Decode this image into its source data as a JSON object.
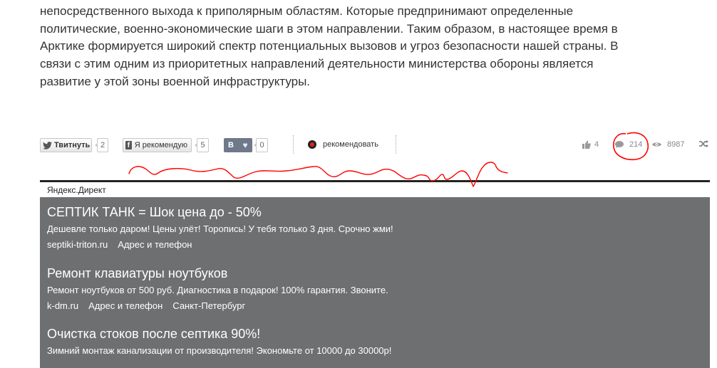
{
  "article": {
    "lines": [
      "непосредственного выхода к приполярным областям. Которые предпринимают определенные",
      "политические, военно-экономические шаги в этом направлении. Таким образом, в настоящее время в",
      "Арктике формируется широкий спектр потенциальных вызовов и угроз безопасности нашей страны. В",
      "связи с этим одним из приоритетных направлений деятельности министерства обороны является",
      "развитие у этой зоны военной инфраструктуры."
    ]
  },
  "share": {
    "twitter_label": "Твитнуть",
    "twitter_count": "2",
    "facebook_label": "Я рекомендую",
    "facebook_count": "5",
    "vk_letter": "В",
    "vk_count": "0",
    "recommend_label": "рекомендовать"
  },
  "stats": {
    "likes": "4",
    "comments": "214",
    "views": "8987"
  },
  "direct": {
    "label": "Яндекс.Директ",
    "ads": [
      {
        "title": "СЕПТИК ТАНК = Шок цена до - 50%",
        "text": "Дешевле только даром! Цены улёт! Торопись! У тебя только 3 дня. Срочно жми!",
        "links": [
          "septiki-triton.ru",
          "Адрес и телефон"
        ]
      },
      {
        "title": "Ремонт клавиатуры ноутбуков",
        "text": "Ремонт ноутбуков от 500 руб. Диагностика в подарок! 100% гарантия. Звоните.",
        "links": [
          "k-dm.ru",
          "Адрес и телефон",
          "Санкт-Петербург"
        ]
      },
      {
        "title": "Очистка стоков после септика 90%!",
        "text": "Зимний монтаж канализации от производителя! Экономьте от 10000 до 30000р!",
        "links": []
      }
    ]
  },
  "colors": {
    "ads_background": "#6e6f70",
    "annotation_red": "#ff0000",
    "recommend_dot": "#e0241b"
  }
}
